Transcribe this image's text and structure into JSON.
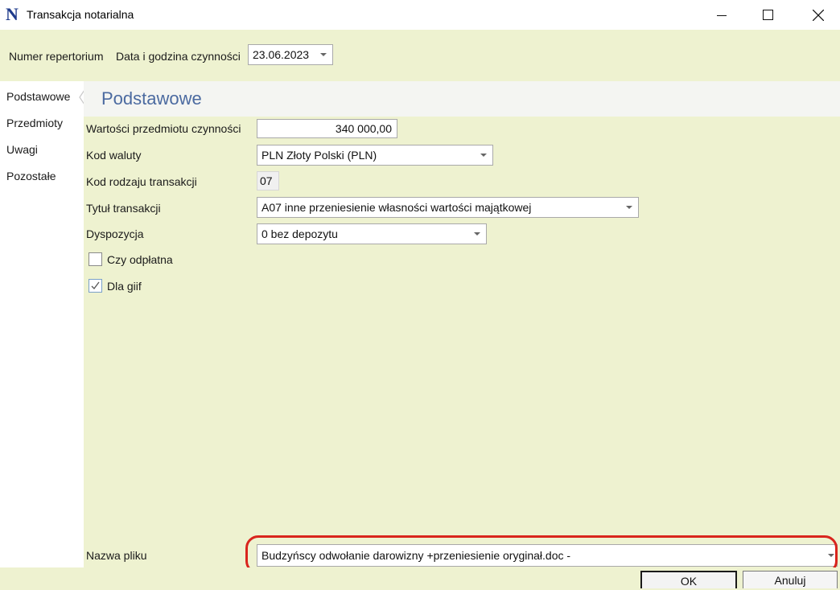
{
  "window": {
    "title": "Transakcja notarialna",
    "app_icon_glyph": "N"
  },
  "header": {
    "repertorium_label": "Numer repertorium",
    "date_label": "Data i godzina czynności",
    "date_value": "23.06.2023"
  },
  "nav": {
    "items": [
      {
        "label": "Podstawowe"
      },
      {
        "label": "Przedmioty"
      },
      {
        "label": "Uwagi"
      },
      {
        "label": "Pozostałe"
      }
    ]
  },
  "panel": {
    "title": "Podstawowe"
  },
  "form": {
    "value_label": "Wartości przedmiotu czynności",
    "value": "340 000,00",
    "currency_label": "Kod waluty",
    "currency_value": "PLN Złoty Polski (PLN)",
    "transaction_code_label": "Kod rodzaju transakcji",
    "transaction_code_value": "07",
    "transaction_title_label": "Tytuł transakcji",
    "transaction_title_value": "A07 inne przeniesienie własności wartości majątkowej",
    "disposition_label": "Dyspozycja",
    "disposition_value": "0 bez depozytu",
    "paid_label": "Czy odpłatna",
    "paid_checked": false,
    "giif_label": "Dla giif",
    "giif_checked": true,
    "filename_label": "Nazwa pliku",
    "filename_value": "Budzyńscy  odwołanie darowizny +przeniesienie oryginał.doc -"
  },
  "buttons": {
    "ok_label": "OK",
    "cancel_label": "Anuluj"
  },
  "colors": {
    "background": "#eef2d0",
    "panel_title": "#4b6aa0",
    "highlight": "#d9251d",
    "app_icon": "#1f3b8c"
  },
  "icons": {
    "minimize": "minimize-icon",
    "maximize": "maximize-icon",
    "close": "close-icon",
    "dropdown": "chevron-down-icon",
    "check": "check-icon"
  }
}
